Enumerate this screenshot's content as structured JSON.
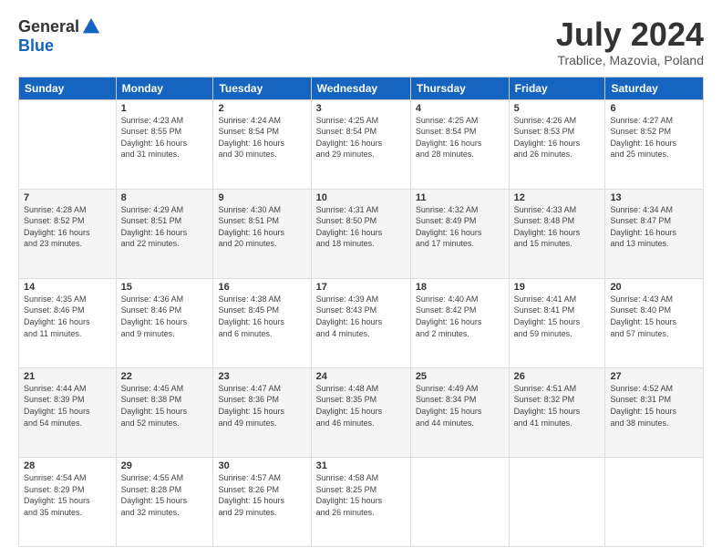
{
  "logo": {
    "general": "General",
    "blue": "Blue"
  },
  "header": {
    "month": "July 2024",
    "location": "Trablice, Mazovia, Poland"
  },
  "days_of_week": [
    "Sunday",
    "Monday",
    "Tuesday",
    "Wednesday",
    "Thursday",
    "Friday",
    "Saturday"
  ],
  "weeks": [
    [
      {
        "day": "",
        "info": ""
      },
      {
        "day": "1",
        "info": "Sunrise: 4:23 AM\nSunset: 8:55 PM\nDaylight: 16 hours\nand 31 minutes."
      },
      {
        "day": "2",
        "info": "Sunrise: 4:24 AM\nSunset: 8:54 PM\nDaylight: 16 hours\nand 30 minutes."
      },
      {
        "day": "3",
        "info": "Sunrise: 4:25 AM\nSunset: 8:54 PM\nDaylight: 16 hours\nand 29 minutes."
      },
      {
        "day": "4",
        "info": "Sunrise: 4:25 AM\nSunset: 8:54 PM\nDaylight: 16 hours\nand 28 minutes."
      },
      {
        "day": "5",
        "info": "Sunrise: 4:26 AM\nSunset: 8:53 PM\nDaylight: 16 hours\nand 26 minutes."
      },
      {
        "day": "6",
        "info": "Sunrise: 4:27 AM\nSunset: 8:52 PM\nDaylight: 16 hours\nand 25 minutes."
      }
    ],
    [
      {
        "day": "7",
        "info": "Sunrise: 4:28 AM\nSunset: 8:52 PM\nDaylight: 16 hours\nand 23 minutes."
      },
      {
        "day": "8",
        "info": "Sunrise: 4:29 AM\nSunset: 8:51 PM\nDaylight: 16 hours\nand 22 minutes."
      },
      {
        "day": "9",
        "info": "Sunrise: 4:30 AM\nSunset: 8:51 PM\nDaylight: 16 hours\nand 20 minutes."
      },
      {
        "day": "10",
        "info": "Sunrise: 4:31 AM\nSunset: 8:50 PM\nDaylight: 16 hours\nand 18 minutes."
      },
      {
        "day": "11",
        "info": "Sunrise: 4:32 AM\nSunset: 8:49 PM\nDaylight: 16 hours\nand 17 minutes."
      },
      {
        "day": "12",
        "info": "Sunrise: 4:33 AM\nSunset: 8:48 PM\nDaylight: 16 hours\nand 15 minutes."
      },
      {
        "day": "13",
        "info": "Sunrise: 4:34 AM\nSunset: 8:47 PM\nDaylight: 16 hours\nand 13 minutes."
      }
    ],
    [
      {
        "day": "14",
        "info": "Sunrise: 4:35 AM\nSunset: 8:46 PM\nDaylight: 16 hours\nand 11 minutes."
      },
      {
        "day": "15",
        "info": "Sunrise: 4:36 AM\nSunset: 8:46 PM\nDaylight: 16 hours\nand 9 minutes."
      },
      {
        "day": "16",
        "info": "Sunrise: 4:38 AM\nSunset: 8:45 PM\nDaylight: 16 hours\nand 6 minutes."
      },
      {
        "day": "17",
        "info": "Sunrise: 4:39 AM\nSunset: 8:43 PM\nDaylight: 16 hours\nand 4 minutes."
      },
      {
        "day": "18",
        "info": "Sunrise: 4:40 AM\nSunset: 8:42 PM\nDaylight: 16 hours\nand 2 minutes."
      },
      {
        "day": "19",
        "info": "Sunrise: 4:41 AM\nSunset: 8:41 PM\nDaylight: 15 hours\nand 59 minutes."
      },
      {
        "day": "20",
        "info": "Sunrise: 4:43 AM\nSunset: 8:40 PM\nDaylight: 15 hours\nand 57 minutes."
      }
    ],
    [
      {
        "day": "21",
        "info": "Sunrise: 4:44 AM\nSunset: 8:39 PM\nDaylight: 15 hours\nand 54 minutes."
      },
      {
        "day": "22",
        "info": "Sunrise: 4:45 AM\nSunset: 8:38 PM\nDaylight: 15 hours\nand 52 minutes."
      },
      {
        "day": "23",
        "info": "Sunrise: 4:47 AM\nSunset: 8:36 PM\nDaylight: 15 hours\nand 49 minutes."
      },
      {
        "day": "24",
        "info": "Sunrise: 4:48 AM\nSunset: 8:35 PM\nDaylight: 15 hours\nand 46 minutes."
      },
      {
        "day": "25",
        "info": "Sunrise: 4:49 AM\nSunset: 8:34 PM\nDaylight: 15 hours\nand 44 minutes."
      },
      {
        "day": "26",
        "info": "Sunrise: 4:51 AM\nSunset: 8:32 PM\nDaylight: 15 hours\nand 41 minutes."
      },
      {
        "day": "27",
        "info": "Sunrise: 4:52 AM\nSunset: 8:31 PM\nDaylight: 15 hours\nand 38 minutes."
      }
    ],
    [
      {
        "day": "28",
        "info": "Sunrise: 4:54 AM\nSunset: 8:29 PM\nDaylight: 15 hours\nand 35 minutes."
      },
      {
        "day": "29",
        "info": "Sunrise: 4:55 AM\nSunset: 8:28 PM\nDaylight: 15 hours\nand 32 minutes."
      },
      {
        "day": "30",
        "info": "Sunrise: 4:57 AM\nSunset: 8:26 PM\nDaylight: 15 hours\nand 29 minutes."
      },
      {
        "day": "31",
        "info": "Sunrise: 4:58 AM\nSunset: 8:25 PM\nDaylight: 15 hours\nand 26 minutes."
      },
      {
        "day": "",
        "info": ""
      },
      {
        "day": "",
        "info": ""
      },
      {
        "day": "",
        "info": ""
      }
    ]
  ]
}
